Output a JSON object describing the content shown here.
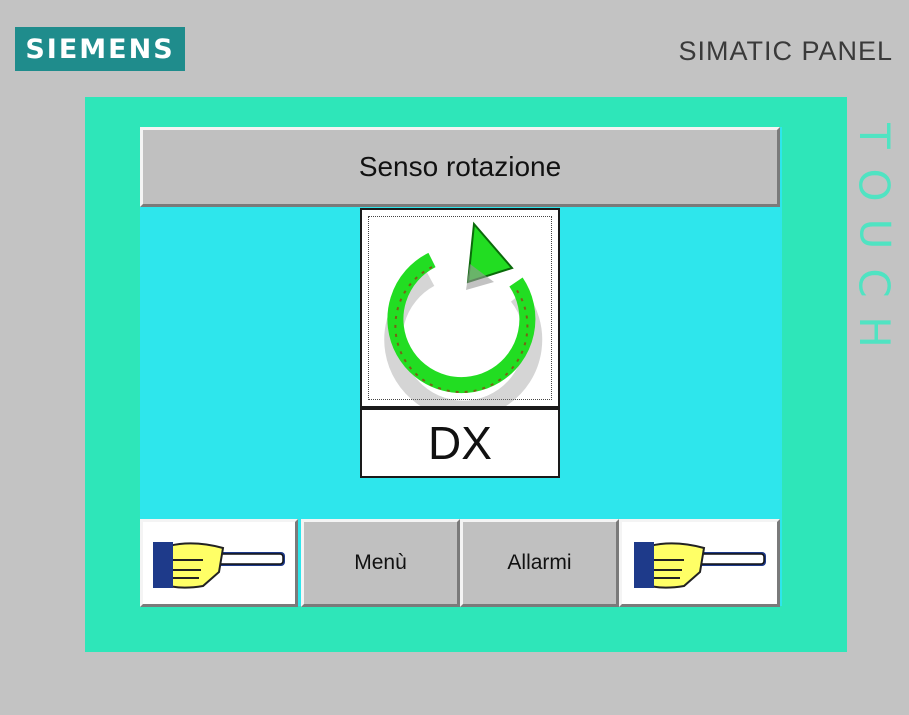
{
  "header": {
    "brand": "SIEMENS",
    "model": "SIMATIC PANEL",
    "touch_label": "TOUCH"
  },
  "screen": {
    "title": "Senso rotazione",
    "rotation_button_icon": "rotate-counterclockwise-icon",
    "direction_value": "DX"
  },
  "nav": {
    "prev_icon": "pointing-hand-left-icon",
    "menu_label": "Menù",
    "alarms_label": "Allarmi",
    "next_icon": "pointing-hand-right-icon"
  },
  "colors": {
    "brand": "#1f8c8c",
    "bezel": "#c3c3c3",
    "frame": "#2ee6b9",
    "screen": "#2ee6ec",
    "arrow": "#22dd22",
    "hand": "#ffff66"
  }
}
